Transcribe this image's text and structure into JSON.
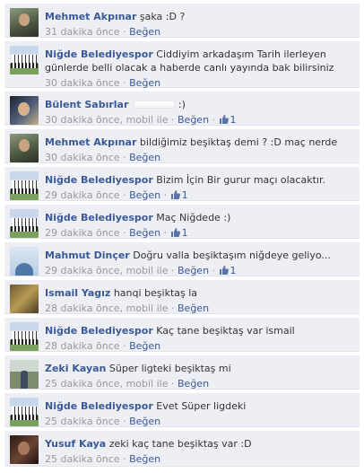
{
  "comments": [
    {
      "author": "Mehmet Akpınar",
      "text": "şaka :D ?",
      "time": "31 dakika önce",
      "via": "",
      "like_label": "Beğen",
      "likes": "",
      "avatar": "person-photo"
    },
    {
      "author": "Niğde Belediyespor",
      "text": "Ciddiyim arkadaşım Tarih ilerleyen günlerde belli olacak a haberde canlı yayında bak bilirsiniz",
      "time": "30 dakika önce",
      "via": "",
      "like_label": "Beğen",
      "likes": "",
      "avatar": "team-photo"
    },
    {
      "author": "Bülent Sabırlar",
      "text": ":)",
      "time": "30 dakika önce",
      "via": "mobil ile",
      "like_label": "Beğen",
      "likes": "1",
      "avatar": "person-photo"
    },
    {
      "author": "Mehmet Akpınar",
      "text": "bildiğimiz beşiktaş demi ? :D maç nerde",
      "time": "30 dakika önce",
      "via": "",
      "like_label": "Beğen",
      "likes": "",
      "avatar": "person-photo"
    },
    {
      "author": "Niğde Belediyespor",
      "text": "Bizim İçin Bir gurur maçı olacaktır.",
      "time": "29 dakika önce",
      "via": "",
      "like_label": "Beğen",
      "likes": "1",
      "avatar": "team-photo"
    },
    {
      "author": "Niğde Belediyespor",
      "text": "Maç Niğdede :)",
      "time": "29 dakika önce",
      "via": "",
      "like_label": "Beğen",
      "likes": "1",
      "avatar": "team-photo"
    },
    {
      "author": "Mahmut Dinçer",
      "text": "Doğru valla beşiktaşım niğdeye geliyo...",
      "time": "29 dakika önce",
      "via": "mobil ile",
      "like_label": "Beğen",
      "likes": "1",
      "avatar": "person-photo"
    },
    {
      "author": "Ismail Yagız",
      "text": "hanqi beşiktaş la",
      "time": "28 dakika önce",
      "via": "mobil ile",
      "like_label": "Beğen",
      "likes": "",
      "avatar": "person-photo"
    },
    {
      "author": "Niğde Belediyespor",
      "text": "Kaç tane beşiktaş var ismail",
      "time": "28 dakika önce",
      "via": "",
      "like_label": "Beğen",
      "likes": "",
      "avatar": "team-photo"
    },
    {
      "author": "Zeki Kayan",
      "text": "Süper ligteki beşiktaş mi",
      "time": "25 dakika önce",
      "via": "mobil ile",
      "like_label": "Beğen",
      "likes": "",
      "avatar": "person-photo"
    },
    {
      "author": "Niğde Belediyespor",
      "text": "Evet Süper ligdeki",
      "time": "25 dakika önce",
      "via": "",
      "like_label": "Beğen",
      "likes": "",
      "avatar": "team-photo"
    },
    {
      "author": "Yusuf Kaya",
      "text": "zeki kaç tane beşiktaş var :D",
      "time": "25 dakika önce",
      "via": "",
      "like_label": "Beğen",
      "likes": "",
      "avatar": "person-photo"
    }
  ],
  "meta_separator": "·",
  "colors": {
    "background": "#edeff4",
    "link": "#3b5998",
    "meta": "#999999",
    "text": "#333333"
  },
  "icons": {
    "like": "thumbs-up-icon"
  }
}
